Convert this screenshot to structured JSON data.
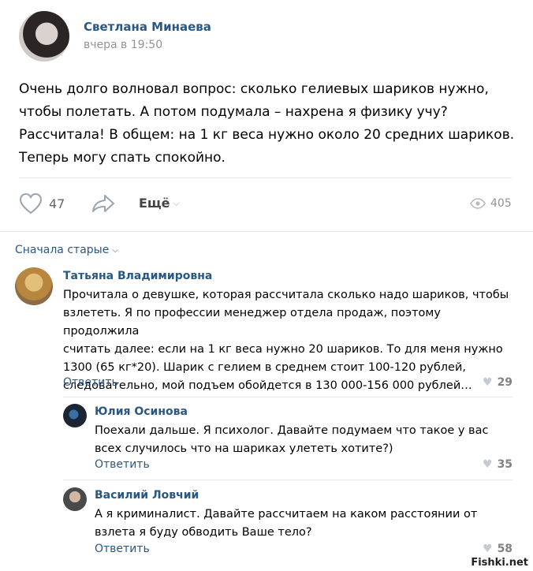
{
  "post": {
    "author": "Светлана Минаева",
    "time": "вчера в 19:50",
    "text": [
      "Очень долго волновал вопрос: сколько гелиевых шариков нужно,",
      "чтобы полетать. А потом подумала – нахрена я физику учу?",
      "Рассчитала! В общем: на 1 кг веса нужно около 20 средних шариков.",
      "Теперь могу спать спокойно."
    ],
    "likes": "47",
    "more_label": "Ещё",
    "views": "405"
  },
  "sort_label": "Сначала старые",
  "comments": [
    {
      "author": "Татьяна Владимировна",
      "text": [
        "Прочитала о девушке, которая рассчитала сколько надо шариков, чтобы",
        "взлететь. Я по профессии менеджер отдела продаж, поэтому продолжила",
        "считать далее: если на 1 кг веса нужно 20 шариков. То для меня нужно",
        "1300 (65 кг*20). Шарик с гелием в среднем стоит 100-120 рублей,",
        "следовательно, мой подъем обойдется в 130 000-156 000 рублей…"
      ],
      "reply": "Ответить",
      "likes": "29"
    },
    {
      "author": "Юлия Осинова",
      "text": [
        "Поехали дальше. Я психолог. Давайте подумаем что такое у вас",
        "всех случилось что на шариках улететь хотите?)"
      ],
      "reply": "Ответить",
      "likes": "35"
    },
    {
      "author": "Василий Ловчий",
      "text": [
        "А я криминалист. Давайте рассчитаем на каком расстоянии от",
        "взлета я буду обводить Ваше тело?"
      ],
      "reply": "Ответить",
      "likes": "58"
    }
  ],
  "watermark": "Fishki.net"
}
